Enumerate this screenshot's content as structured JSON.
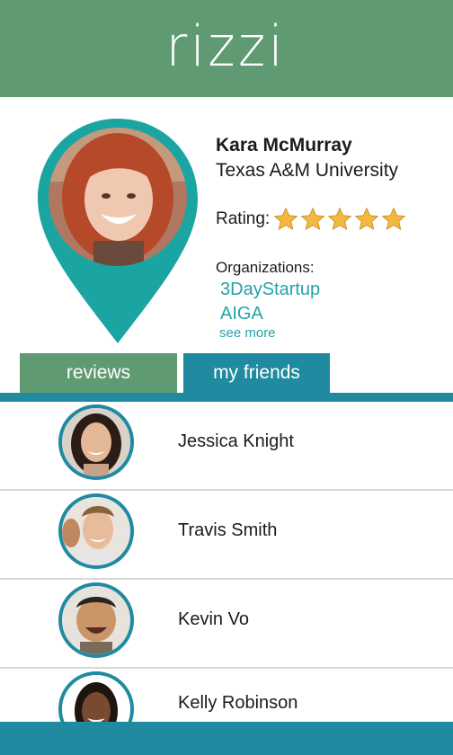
{
  "app": {
    "logo_text": "rizzi"
  },
  "profile": {
    "name": "Kara McMurray",
    "school": "Texas A&M University",
    "rating_label": "Rating:",
    "rating": 5,
    "rating_max": 5,
    "organizations_label": "Organizations:",
    "organizations": [
      "3DayStartup",
      "AIGA"
    ],
    "see_more": "see more"
  },
  "tabs": [
    {
      "label": "reviews",
      "active": false
    },
    {
      "label": "my friends",
      "active": true
    }
  ],
  "friends": [
    {
      "name": "Jessica Knight"
    },
    {
      "name": "Travis Smith"
    },
    {
      "name": "Kevin Vo"
    },
    {
      "name": "Kelly Robinson"
    }
  ],
  "colors": {
    "header_green": "#5f9a72",
    "teal": "#23a3a9",
    "tab_blue": "#1f8aa0",
    "star": "#f5b83f"
  }
}
